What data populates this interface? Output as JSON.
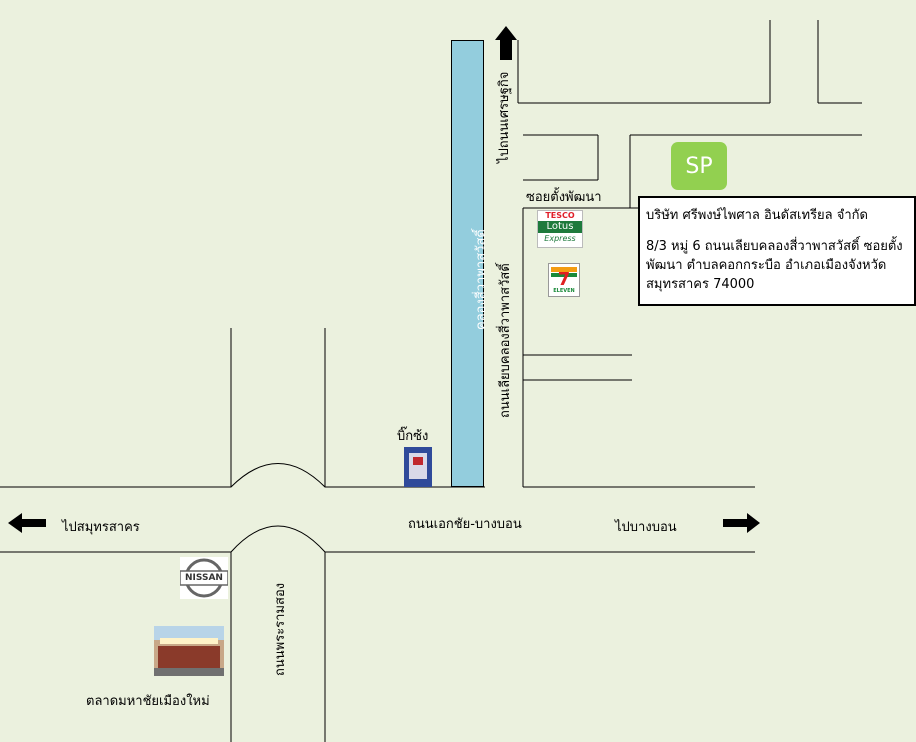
{
  "map": {
    "canal_label": "คลองสี่วาพาสวัสดิ์",
    "roads": {
      "main_road": "ถนนเอกชัย-บางบอน",
      "canal_road": "ถนนเลียบคลองสี่วาพาสวัสดิ์",
      "to_setthakit": "ไปถนนเศรษฐกิจ",
      "soi": "ซอยตั้งพัฒนา",
      "rama2": "ถนนพระรามสอง"
    },
    "directions": {
      "left": "ไปสมุทรสาคร",
      "right": "ไปบางบอน"
    },
    "landmarks": {
      "bigc": "บิ๊กซ้ง",
      "market": "ตลาดมหาชัยเมืองใหม่",
      "tesco_line1": "TESCO",
      "tesco_line2": "Lotus",
      "tesco_line3": "Express",
      "seven": "7",
      "seven_sub": "ELEVEN",
      "nissan": "NISSAN"
    },
    "destination": {
      "badge": "SP",
      "company": "บริษัท ศรีพงษ์ไพศาล อินดัสเทรียล จำกัด",
      "address": "8/3 หมู่ 6 ถนนเลียบคลองสี่วาพาสวัสดิ์ ซอยตั้งพัฒนา ตำบลคอกกระบือ อำเภอเมืองจังหวัดสมุทรสาคร 74000"
    },
    "colors": {
      "background": "#ebf1de",
      "canal": "#93cddd",
      "badge": "#92d050",
      "tesco_red": "#e0202a",
      "lotus_green": "#1e7a3c",
      "seven_orange": "#f39c12",
      "seven_green": "#1a8a3a",
      "seven_red": "#e02020"
    },
    "icons": [
      "arrow-up-icon",
      "arrow-left-icon",
      "arrow-right-icon"
    ]
  }
}
